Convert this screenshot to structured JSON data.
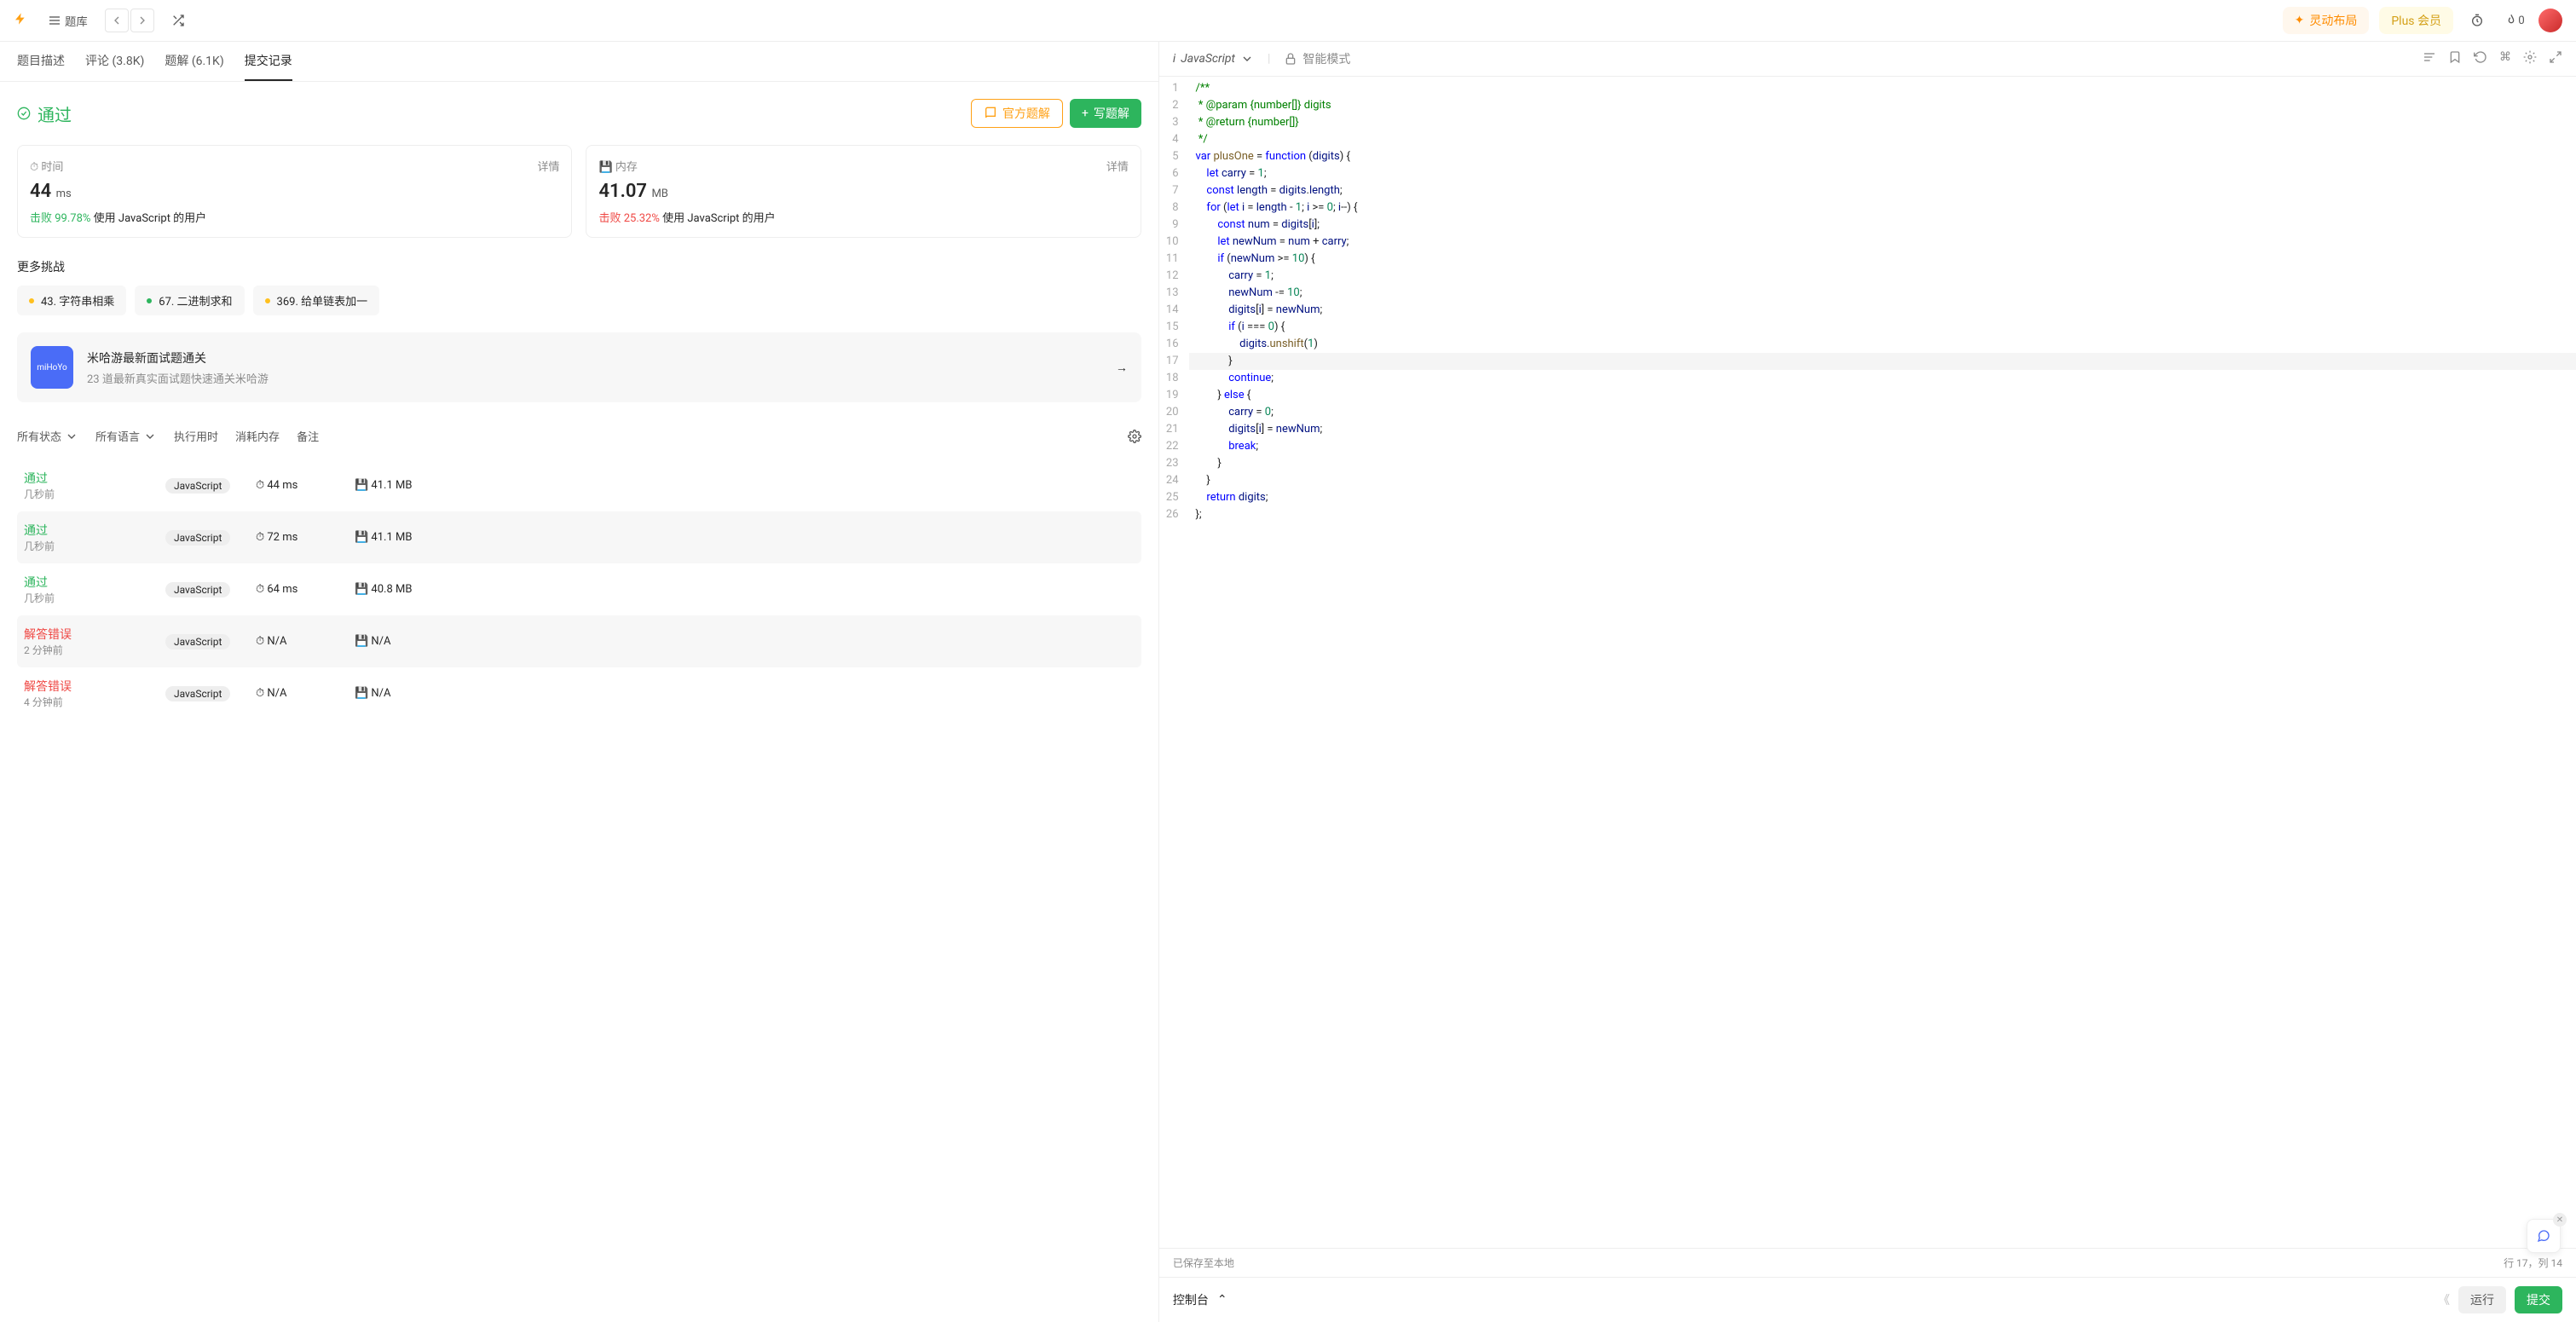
{
  "topbar": {
    "problems": "题库",
    "layout": "灵动布局",
    "plus": "Plus 会员",
    "fire_count": "0"
  },
  "tabs": {
    "desc": "题目描述",
    "discuss": "评论 (3.8K)",
    "solutions": "题解 (6.1K)",
    "submissions": "提交记录"
  },
  "result": {
    "status": "通过",
    "official": "官方题解",
    "write": "写题解"
  },
  "stats": {
    "time_label": "时间",
    "mem_label": "内存",
    "detail": "详情",
    "time_val": "44",
    "time_unit": "ms",
    "time_beat_label": "击败",
    "time_beat": "99.78%",
    "time_note": "使用 JavaScript 的用户",
    "mem_val": "41.07",
    "mem_unit": "MB",
    "mem_beat_label": "击败",
    "mem_beat": "25.32%",
    "mem_note": "使用 JavaScript 的用户"
  },
  "more": "更多挑战",
  "challenges": [
    {
      "label": "43. 字符串相乘",
      "dot": "yellow"
    },
    {
      "label": "67. 二进制求和",
      "dot": "green"
    },
    {
      "label": "369. 给单链表加一",
      "dot": "yellow"
    }
  ],
  "promo": {
    "icon_text": "miHoYo",
    "title": "米哈游最新面试题通关",
    "sub": "23 道最新真实面试题快速通关米哈游"
  },
  "filters": {
    "status": "所有状态",
    "lang": "所有语言",
    "runtime": "执行用时",
    "memory": "消耗内存",
    "note": "备注"
  },
  "submissions": [
    {
      "status": "通过",
      "statusClass": "pass",
      "ago": "几秒前",
      "lang": "JavaScript",
      "rt": "44 ms",
      "mem": "41.1 MB"
    },
    {
      "status": "通过",
      "statusClass": "pass",
      "ago": "几秒前",
      "lang": "JavaScript",
      "rt": "72 ms",
      "mem": "41.1 MB"
    },
    {
      "status": "通过",
      "statusClass": "pass",
      "ago": "几秒前",
      "lang": "JavaScript",
      "rt": "64 ms",
      "mem": "40.8 MB"
    },
    {
      "status": "解答错误",
      "statusClass": "err",
      "ago": "2 分钟前",
      "lang": "JavaScript",
      "rt": "N/A",
      "mem": "N/A"
    },
    {
      "status": "解答错误",
      "statusClass": "err",
      "ago": "4 分钟前",
      "lang": "JavaScript",
      "rt": "N/A",
      "mem": "N/A"
    }
  ],
  "editor": {
    "lang": "JavaScript",
    "mode": "智能模式",
    "saved": "已保存至本地",
    "cursor": "行 17，列 14",
    "console": "控制台",
    "run": "运行",
    "submit": "提交"
  },
  "code_lines": [
    {
      "n": 1,
      "html": "<span class='cmt'>/**</span>"
    },
    {
      "n": 2,
      "html": "<span class='cmt'> * @param {number[]} digits</span>"
    },
    {
      "n": 3,
      "html": "<span class='cmt'> * @return {number[]}</span>"
    },
    {
      "n": 4,
      "html": "<span class='cmt'> */</span>"
    },
    {
      "n": 5,
      "html": "<span class='kw'>var</span> <span class='fn'>plusOne</span> = <span class='kw'>function</span> (<span class='var'>digits</span>) {"
    },
    {
      "n": 6,
      "html": "    <span class='kw'>let</span> <span class='var'>carry</span> = <span class='num'>1</span>;"
    },
    {
      "n": 7,
      "html": "    <span class='kw'>const</span> <span class='var'>length</span> = <span class='var'>digits</span>.<span class='var'>length</span>;"
    },
    {
      "n": 8,
      "html": "    <span class='kw'>for</span> (<span class='kw'>let</span> <span class='var'>i</span> = <span class='var'>length</span> - <span class='num'>1</span>; <span class='var'>i</span> &gt;= <span class='num'>0</span>; <span class='var'>i</span>--) {"
    },
    {
      "n": 9,
      "html": "        <span class='kw'>const</span> <span class='var'>num</span> = <span class='var'>digits</span>[<span class='var'>i</span>];"
    },
    {
      "n": 10,
      "html": "        <span class='kw'>let</span> <span class='var'>newNum</span> = <span class='var'>num</span> + <span class='var'>carry</span>;"
    },
    {
      "n": 11,
      "html": "        <span class='kw'>if</span> (<span class='var'>newNum</span> &gt;= <span class='num'>10</span>) {"
    },
    {
      "n": 12,
      "html": "            <span class='var'>carry</span> = <span class='num'>1</span>;"
    },
    {
      "n": 13,
      "html": "            <span class='var'>newNum</span> -= <span class='num'>10</span>;"
    },
    {
      "n": 14,
      "html": "            <span class='var'>digits</span>[<span class='var'>i</span>] = <span class='var'>newNum</span>;"
    },
    {
      "n": 15,
      "html": "            <span class='kw'>if</span> (<span class='var'>i</span> === <span class='num'>0</span>) {"
    },
    {
      "n": 16,
      "html": "                <span class='var'>digits</span>.<span class='fn'>unshift</span>(<span class='num'>1</span>)"
    },
    {
      "n": 17,
      "html": "            }",
      "hl": true
    },
    {
      "n": 18,
      "html": "            <span class='kw'>continue</span>;"
    },
    {
      "n": 19,
      "html": "        } <span class='kw'>else</span> {"
    },
    {
      "n": 20,
      "html": "            <span class='var'>carry</span> = <span class='num'>0</span>;"
    },
    {
      "n": 21,
      "html": "            <span class='var'>digits</span>[<span class='var'>i</span>] = <span class='var'>newNum</span>;"
    },
    {
      "n": 22,
      "html": "            <span class='kw'>break</span>;"
    },
    {
      "n": 23,
      "html": "        }"
    },
    {
      "n": 24,
      "html": "    }"
    },
    {
      "n": 25,
      "html": "    <span class='kw'>return</span> <span class='var'>digits</span>;"
    },
    {
      "n": 26,
      "html": "};"
    }
  ]
}
